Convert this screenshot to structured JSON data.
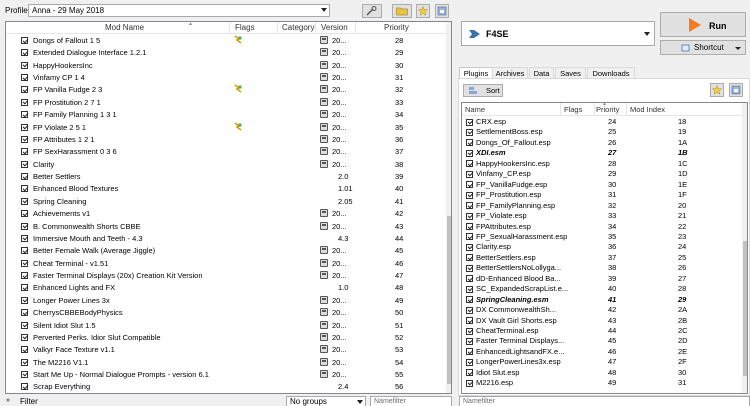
{
  "profile": {
    "label": "Profile",
    "value": "Anna - 29 May 2018"
  },
  "modlist": {
    "headers": {
      "name": "Mod Name",
      "flags": "Flags",
      "category": "Category",
      "version": "Version",
      "priority": "Priority"
    },
    "rows": [
      {
        "name": "Dongs of Fallout 1 5",
        "flag": true,
        "version": "20...",
        "vicon": true,
        "priority": "28"
      },
      {
        "name": "Extended Dialogue Interface 1.2.1",
        "flag": false,
        "version": "20...",
        "vicon": true,
        "priority": "29"
      },
      {
        "name": "HappyHookersInc",
        "flag": false,
        "version": "20...",
        "vicon": true,
        "priority": "30"
      },
      {
        "name": "Vinfamy CP 1 4",
        "flag": false,
        "version": "20...",
        "vicon": true,
        "priority": "31"
      },
      {
        "name": "FP Vanilla Fudge 2 3",
        "flag": true,
        "version": "20...",
        "vicon": true,
        "priority": "32"
      },
      {
        "name": "FP Prostitution 2 7 1",
        "flag": false,
        "version": "20...",
        "vicon": true,
        "priority": "33"
      },
      {
        "name": "FP Family Planning 1 3 1",
        "flag": false,
        "version": "20...",
        "vicon": true,
        "priority": "34"
      },
      {
        "name": "FP Violate 2 5 1",
        "flag": true,
        "version": "20...",
        "vicon": true,
        "priority": "35"
      },
      {
        "name": "FP Attributes 1 2 1",
        "flag": false,
        "version": "20...",
        "vicon": true,
        "priority": "36"
      },
      {
        "name": "FP SexHarassment 0 3 6",
        "flag": false,
        "version": "20...",
        "vicon": true,
        "priority": "37"
      },
      {
        "name": "Clarity",
        "flag": false,
        "version": "20...",
        "vicon": true,
        "priority": "38"
      },
      {
        "name": "Better Settlers",
        "flag": false,
        "version": "2.0",
        "vicon": false,
        "priority": "39"
      },
      {
        "name": "Enhanced Blood Textures",
        "flag": false,
        "version": "1.01",
        "vicon": false,
        "priority": "40"
      },
      {
        "name": "Spring Cleaning",
        "flag": false,
        "version": "2.05",
        "vicon": false,
        "priority": "41"
      },
      {
        "name": "Achievements v1",
        "flag": false,
        "version": "20...",
        "vicon": true,
        "priority": "42"
      },
      {
        "name": "B. Commonwealth Shorts CBBE",
        "flag": false,
        "version": "20...",
        "vicon": true,
        "priority": "43"
      },
      {
        "name": "Immersive Mouth and Teeth - 4.3",
        "flag": false,
        "version": "4.3",
        "vicon": false,
        "priority": "44"
      },
      {
        "name": "Better Female Walk (Average Jiggle)",
        "flag": false,
        "version": "20...",
        "vicon": true,
        "priority": "45"
      },
      {
        "name": "Cheat Terminal - v1.51",
        "flag": false,
        "version": "20...",
        "vicon": true,
        "priority": "46"
      },
      {
        "name": "Faster Terminal Displays (20x) Creation Kit Version",
        "flag": false,
        "version": "20...",
        "vicon": true,
        "priority": "47"
      },
      {
        "name": "Enhanced Lights and FX",
        "flag": false,
        "version": "1.0",
        "vicon": false,
        "priority": "48"
      },
      {
        "name": "Longer Power Lines 3x",
        "flag": false,
        "version": "20...",
        "vicon": true,
        "priority": "49"
      },
      {
        "name": "CherrysCBBEBodyPhysics",
        "flag": false,
        "version": "20...",
        "vicon": true,
        "priority": "50"
      },
      {
        "name": "Silent Idiot Slut 1.5",
        "flag": false,
        "version": "20...",
        "vicon": true,
        "priority": "51"
      },
      {
        "name": "Perverted Perks. Idior Slut Compatible",
        "flag": false,
        "version": "20...",
        "vicon": true,
        "priority": "52"
      },
      {
        "name": "Valkyr Face Texture v1.1",
        "flag": false,
        "version": "20...",
        "vicon": true,
        "priority": "53"
      },
      {
        "name": "The M2216 V1.1",
        "flag": false,
        "version": "20...",
        "vicon": true,
        "priority": "54"
      },
      {
        "name": "Start Me Up - Normal Dialogue Prompts - version 6.1",
        "flag": false,
        "version": "20...",
        "vicon": true,
        "priority": "55"
      },
      {
        "name": "Scrap Everything",
        "flag": false,
        "version": "2.4",
        "vicon": false,
        "priority": "56"
      }
    ]
  },
  "bottom": {
    "filter_label": "Filter",
    "groups_value": "No groups",
    "namefilter_placeholder": "Namefilter"
  },
  "executable": {
    "name": "F4SE"
  },
  "run_label": "Run",
  "shortcut_label": "Shortcut",
  "tabs": [
    "Plugins",
    "Archives",
    "Data",
    "Saves",
    "Downloads"
  ],
  "sort_label": "Sort",
  "plugins": {
    "headers": {
      "name": "Name",
      "flags": "Flags",
      "priority": "Priority",
      "modindex": "Mod Index"
    },
    "rows": [
      {
        "name": "CRX.esp",
        "priority": "24",
        "index": "18",
        "master": false
      },
      {
        "name": "SettlementBoss.esp",
        "priority": "25",
        "index": "19",
        "master": false
      },
      {
        "name": "Dongs_Of_Fallout.esp",
        "priority": "26",
        "index": "1A",
        "master": false
      },
      {
        "name": "XDI.esm",
        "priority": "27",
        "index": "1B",
        "master": true
      },
      {
        "name": "HappyHookersInc.esp",
        "priority": "28",
        "index": "1C",
        "master": false
      },
      {
        "name": "Vinfamy_CP.esp",
        "priority": "29",
        "index": "1D",
        "master": false
      },
      {
        "name": "FP_VanillaFudge.esp",
        "priority": "30",
        "index": "1E",
        "master": false
      },
      {
        "name": "FP_Prostitution.esp",
        "priority": "31",
        "index": "1F",
        "master": false
      },
      {
        "name": "FP_FamilyPlanning.esp",
        "priority": "32",
        "index": "20",
        "master": false
      },
      {
        "name": "FP_Violate.esp",
        "priority": "33",
        "index": "21",
        "master": false
      },
      {
        "name": "FPAttributes.esp",
        "priority": "34",
        "index": "22",
        "master": false
      },
      {
        "name": "FP_SexualHarassment.esp",
        "priority": "35",
        "index": "23",
        "master": false
      },
      {
        "name": "Clarity.esp",
        "priority": "36",
        "index": "24",
        "master": false
      },
      {
        "name": "BetterSettlers.esp",
        "priority": "37",
        "index": "25",
        "master": false
      },
      {
        "name": "BetterSettlersNoLollyga...",
        "priority": "38",
        "index": "26",
        "master": false
      },
      {
        "name": "dD-Enhanced Blood Ba...",
        "priority": "39",
        "index": "27",
        "master": false
      },
      {
        "name": "SC_ExpandedScrapList.e...",
        "priority": "40",
        "index": "28",
        "master": false
      },
      {
        "name": "SpringCleaning.esm",
        "priority": "41",
        "index": "29",
        "master": true
      },
      {
        "name": "DX CommonwealthSh...",
        "priority": "42",
        "index": "2A",
        "master": false
      },
      {
        "name": "DX Vault Girl Shorts.esp",
        "priority": "43",
        "index": "2B",
        "master": false
      },
      {
        "name": "CheatTerminal.esp",
        "priority": "44",
        "index": "2C",
        "master": false
      },
      {
        "name": "Faster Terminal Displays...",
        "priority": "45",
        "index": "2D",
        "master": false
      },
      {
        "name": "EnhancedLightsandFX.e...",
        "priority": "46",
        "index": "2E",
        "master": false
      },
      {
        "name": "LongerPowerLines3x.esp",
        "priority": "47",
        "index": "2F",
        "master": false
      },
      {
        "name": "Idiot Slut.esp",
        "priority": "48",
        "index": "30",
        "master": false
      },
      {
        "name": "M2216.esp",
        "priority": "49",
        "index": "31",
        "master": false
      }
    ]
  },
  "plugin_namefilter_placeholder": "Namefilter",
  "colors": {
    "run_icon": "#f47b20",
    "accent": "#0078d7"
  }
}
